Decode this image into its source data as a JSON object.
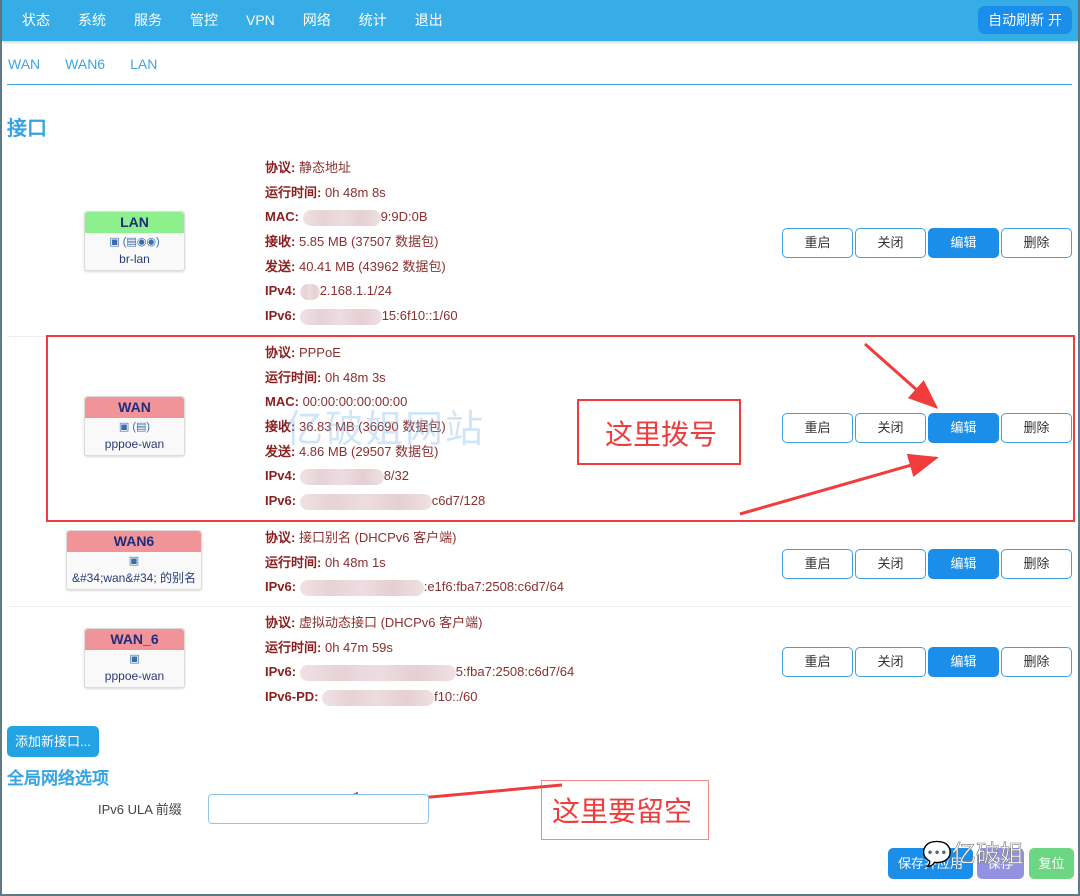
{
  "topbar": {
    "menu": [
      "状态",
      "系统",
      "服务",
      "管控",
      "VPN",
      "网络",
      "统计",
      "退出"
    ],
    "auto_refresh": "自动刷新 开"
  },
  "tabs": [
    "WAN",
    "WAN6",
    "LAN"
  ],
  "section_title": "接口",
  "actions": {
    "restart": "重启",
    "stop": "关闭",
    "edit": "编辑",
    "delete": "删除"
  },
  "interfaces": [
    {
      "name": "LAN",
      "color": "#8ef08c",
      "icons": "▣ (▤◉◉)",
      "device": "br-lan",
      "protocol_label": "协议:",
      "protocol": "静态地址",
      "uptime_label": "运行时间:",
      "uptime": "0h 48m 8s",
      "mac_label": "MAC:",
      "mac": "9:9D:0B",
      "rx_label": "接收:",
      "rx": "5.85 MB (37507 数据包)",
      "tx_label": "发送:",
      "tx": "40.41 MB (43962 数据包)",
      "ipv4_label": "IPv4:",
      "ipv4": "2.168.1.1/24",
      "ipv6_label": "IPv6:",
      "ipv6": "15:6f10::1/60"
    },
    {
      "name": "WAN",
      "color": "#f0949a",
      "icons": "▣ (▤)",
      "device": "pppoe-wan",
      "protocol_label": "协议:",
      "protocol": "PPPoE",
      "uptime_label": "运行时间:",
      "uptime": "0h 48m 3s",
      "mac_label": "MAC:",
      "mac": "00:00:00:00:00:00",
      "rx_label": "接收:",
      "rx": "36.83 MB (36690 数据包)",
      "tx_label": "发送:",
      "tx": "4.86 MB (29507 数据包)",
      "ipv4_label": "IPv4:",
      "ipv4": "8/32",
      "ipv6_label": "IPv6:",
      "ipv6": "c6d7/128"
    },
    {
      "name": "WAN6",
      "color": "#f0949a",
      "icons": "▣",
      "device": "&#34;wan&#34; 的别名",
      "protocol_label": "协议:",
      "protocol": "接口别名 (DHCPv6 客户端)",
      "uptime_label": "运行时间:",
      "uptime": "0h 48m 1s",
      "ipv6_label": "IPv6:",
      "ipv6": ":e1f6:fba7:2508:c6d7/64"
    },
    {
      "name": "WAN_6",
      "color": "#f0949a",
      "icons": "▣",
      "device": "pppoe-wan",
      "protocol_label": "协议:",
      "protocol": "虚拟动态接口 (DHCPv6 客户端)",
      "uptime_label": "运行时间:",
      "uptime": "0h 47m 59s",
      "ipv6_label": "IPv6:",
      "ipv6": "5:fba7:2508:c6d7/64",
      "ipv6pd_label": "IPv6-PD:",
      "ipv6pd": "f10::/60"
    }
  ],
  "add_interface": "添加新接口...",
  "global_title": "全局网络选项",
  "ula": {
    "label": "IPv6 ULA 前缀",
    "value": "",
    "placeholder": ""
  },
  "footer": {
    "save_apply": "保存并应用",
    "save": "保存",
    "reset": "复位"
  },
  "annotations": {
    "dial_here": "这里拨号",
    "leave_empty": "这里要留空",
    "watermark": "亿破姐网站",
    "wechat": "亿破姐",
    "color": "#f03c3c"
  }
}
